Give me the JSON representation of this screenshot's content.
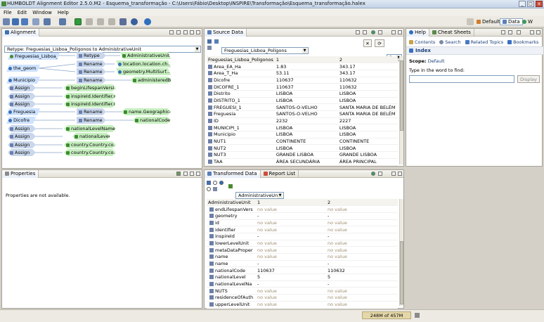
{
  "window": {
    "title": "HUMBOLDT Alignment Editor 2.5.0.M2 - Esquema_transformação - C:\\Users\\Fábio\\Desktop\\INSPIRE\\Transformação\\Esquema_transformação.halex"
  },
  "menu": [
    "File",
    "Edit",
    "Window",
    "Help"
  ],
  "perspectives": {
    "default": "Default",
    "data": "Data",
    "more": "W"
  },
  "alignment": {
    "tab": "Alignment",
    "combo": "Retype: Freguesias_Lisboa_Poligonos to AdministrativeUnit",
    "sources": [
      "Freguesias_Lisboa_...",
      "the_geom",
      "Municipio",
      "Freguesia",
      "Dicofre"
    ],
    "functions": [
      "Retype",
      "Rename",
      "Rename",
      "Rename",
      "Rename",
      "Rename"
    ],
    "targets": [
      "AdministrativeUnit",
      "location.location.ch...",
      "geometry.MultiSurf...",
      "administeredBy",
      "name.Geographical...",
      "nationalCode"
    ],
    "assigns": [
      "Assign",
      "Assign",
      "Assign",
      "Assign",
      "Assign",
      "Assign",
      "Assign"
    ],
    "assign_targets": [
      "beginLifespanVersi...",
      "inspireId.Identifier.n...",
      "inspireId.Identifier.l...",
      "nationalLevelName...",
      "nationalLevel",
      "country.Country.co...",
      "country.Country.co..."
    ]
  },
  "properties": {
    "tab": "Properties",
    "message": "Properties are not available."
  },
  "source_data": {
    "tab": "Source Data",
    "type_combo": "Freguesias_Lisboa_Poligons",
    "count_combo": "2",
    "header": [
      "Freguesias_Lisboa_Poligonos",
      "1",
      "2"
    ],
    "rows": [
      [
        "Area_EA_Ha",
        "1.83",
        "343.17"
      ],
      [
        "Area_T_Ha",
        "53.11",
        "343.17"
      ],
      [
        "Dicofre",
        "110637",
        "110632"
      ],
      [
        "DICOFRE_1",
        "110637",
        "110632"
      ],
      [
        "Distrito",
        "LISBOA",
        "LISBOA"
      ],
      [
        "DISTRITO_1",
        "LISBOA",
        "LISBOA"
      ],
      [
        "FREGUESI_1",
        "SANTOS-O-VELHO",
        "SANTA MARIA DE BELÉM"
      ],
      [
        "Freguesia",
        "SANTOS-O-VELHO",
        "SANTA MARIA DE BELÉM"
      ],
      [
        "ID",
        "2232",
        "2227"
      ],
      [
        "MUNICIPI_1",
        "LISBOA",
        "LISBOA"
      ],
      [
        "Municipio",
        "LISBOA",
        "LISBOA"
      ],
      [
        "NUT1",
        "CONTINENTE",
        "CONTINENTE"
      ],
      [
        "NUT2",
        "LISBOA",
        "LISBOA"
      ],
      [
        "NUT3",
        "GRANDE LISBOA",
        "GRANDE LISBOA"
      ],
      [
        "TAA",
        "ÁREA SECUNDÁRIA",
        "ÁREA PRINCIPAL"
      ]
    ]
  },
  "help": {
    "tab": "Help",
    "tab2": "Cheat Sheets",
    "links": [
      "Contents",
      "Search",
      "Related Topics",
      "Bookmarks"
    ],
    "title": "Index",
    "scope_label": "Scope:",
    "scope_value": "Default",
    "prompt": "Type in the word to find:",
    "display_button": "Display"
  },
  "transformed": {
    "tab": "Transformed Data",
    "tab2": "Report List",
    "type_combo": "AdministrativeUnit",
    "header": [
      "AdministrativeUnit",
      "1",
      "2"
    ],
    "rows": [
      [
        "endLifespanVers",
        "no value",
        "no value"
      ],
      [
        "geometry",
        "-",
        "-"
      ],
      [
        "id",
        "no value",
        "no value"
      ],
      [
        "identifier",
        "no value",
        "no value"
      ],
      [
        "inspireId",
        "-",
        "-"
      ],
      [
        "lowerLevelUnit",
        "no value",
        "no value"
      ],
      [
        "metaDataProper",
        "no value",
        "no value"
      ],
      [
        "name",
        "no value",
        "no value"
      ],
      [
        "name",
        "-",
        "-"
      ],
      [
        "nationalCode",
        "110637",
        "110632"
      ],
      [
        "nationalLevel",
        "5",
        "5"
      ],
      [
        "nationalLevelNa",
        "-",
        "-"
      ],
      [
        "NUTS",
        "no value",
        "no value"
      ],
      [
        "residenceOfAuth",
        "no value",
        "no value"
      ],
      [
        "upperLevelUnit",
        "no value",
        "no value"
      ]
    ]
  },
  "status": {
    "heap": "248M of 457M"
  }
}
